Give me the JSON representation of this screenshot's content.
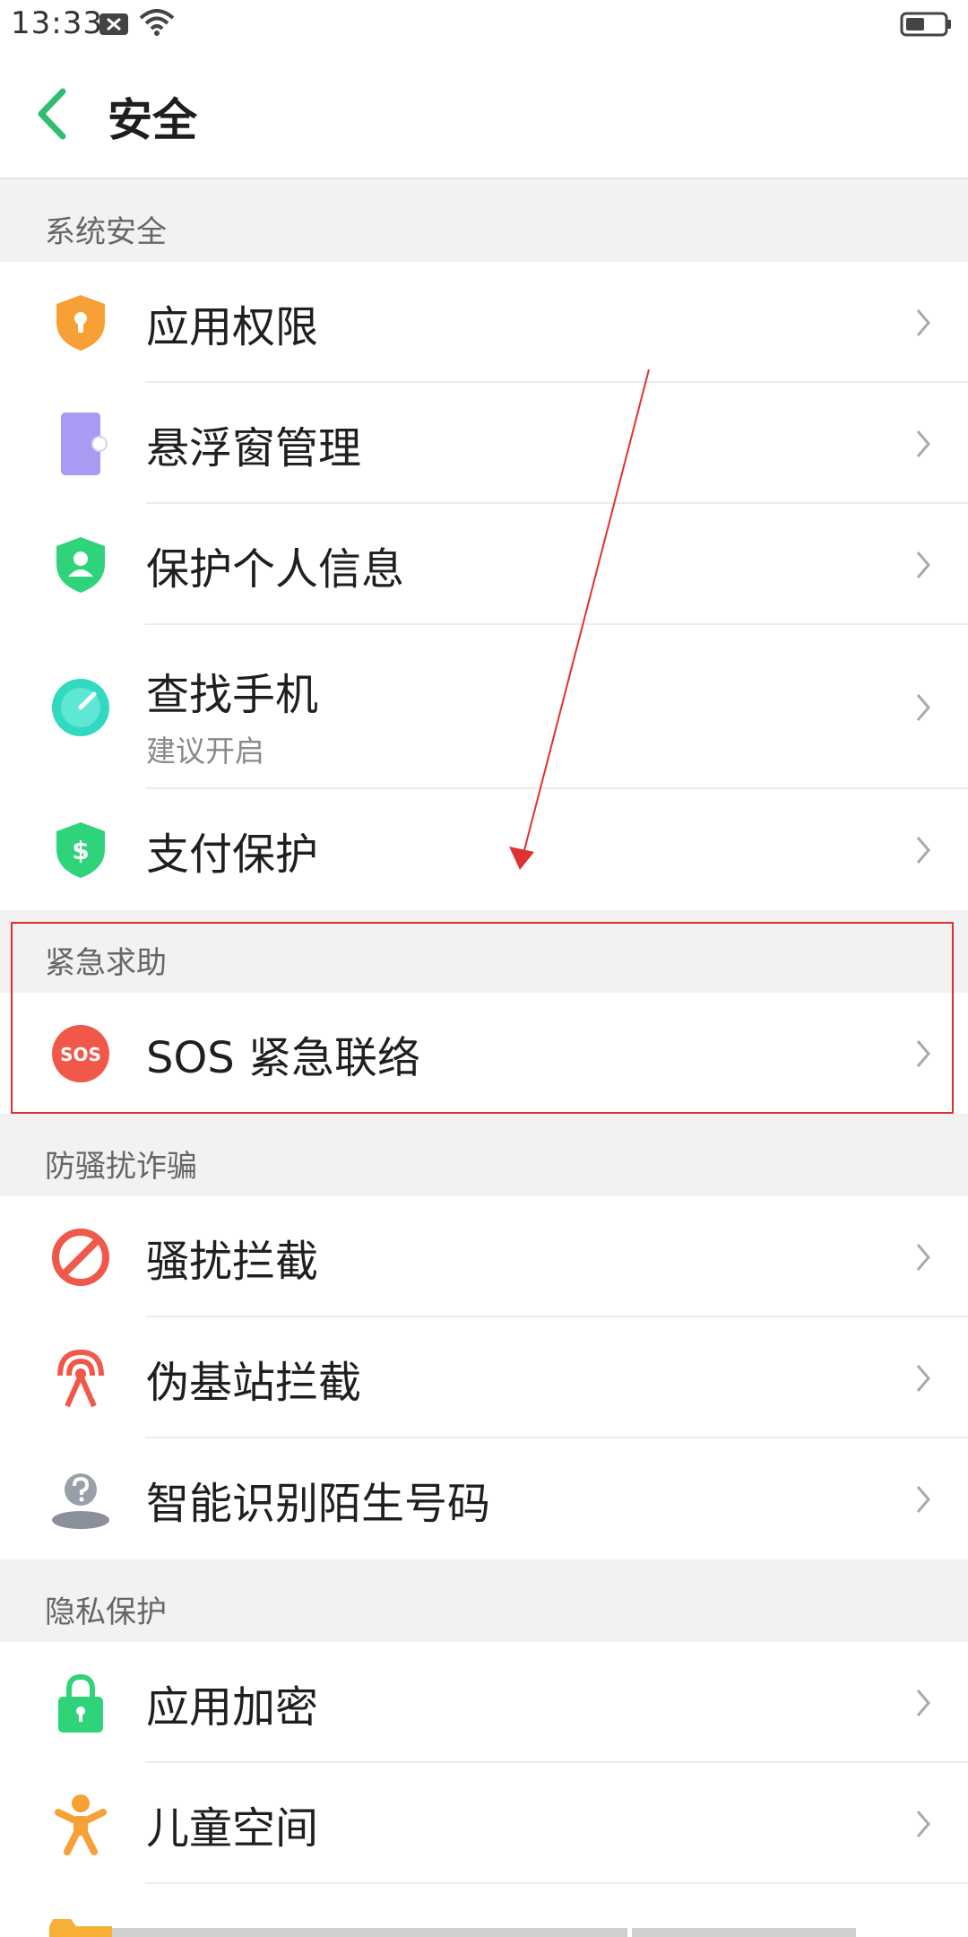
{
  "status_bar": {
    "time": "13:33"
  },
  "header": {
    "title": "安全"
  },
  "sections": [
    {
      "title": "系统安全",
      "items": [
        {
          "label": "应用权限",
          "icon": "shield-key-icon"
        },
        {
          "label": "悬浮窗管理",
          "icon": "floating-window-icon"
        },
        {
          "label": "保护个人信息",
          "icon": "shield-person-icon"
        },
        {
          "label": "查找手机",
          "sublabel": "建议开启",
          "icon": "find-phone-icon"
        },
        {
          "label": "支付保护",
          "icon": "shield-dollar-icon"
        }
      ]
    },
    {
      "title": "紧急求助",
      "items": [
        {
          "label": "SOS 紧急联络",
          "icon": "sos-icon",
          "icon_text": "SOS"
        }
      ]
    },
    {
      "title": "防骚扰诈骗",
      "items": [
        {
          "label": "骚扰拦截",
          "icon": "block-icon"
        },
        {
          "label": "伪基站拦截",
          "icon": "signal-tower-icon"
        },
        {
          "label": "智能识别陌生号码",
          "icon": "unknown-caller-icon"
        }
      ]
    },
    {
      "title": "隐私保护",
      "items": [
        {
          "label": "应用加密",
          "icon": "lock-icon"
        },
        {
          "label": "儿童空间",
          "icon": "child-icon"
        }
      ]
    }
  ],
  "colors": {
    "accent": "#2dbf6e",
    "annotation": "#e03030",
    "orange": "#f7a035",
    "purple": "#9a8cf0",
    "green": "#2fd37a",
    "teal": "#30d9c0",
    "red": "#f0584a"
  }
}
